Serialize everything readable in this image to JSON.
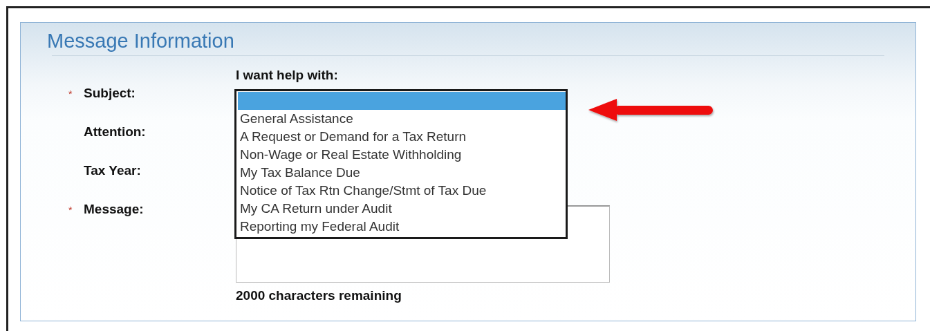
{
  "panel": {
    "title": "Message Information"
  },
  "fields": [
    {
      "label": "Subject:",
      "required_mark": "*"
    },
    {
      "label": "Attention:"
    },
    {
      "label": "Tax Year:"
    },
    {
      "label": "Message:",
      "required_mark": "*"
    }
  ],
  "subject": {
    "prompt": "I want help with:",
    "blank_option_selected": true,
    "options": [
      {
        "label": "General Assistance",
        "selected": false
      },
      {
        "label": "A Request or Demand for a Tax Return",
        "selected": false
      },
      {
        "label": "Non-Wage or Real Estate Withholding",
        "selected": false
      },
      {
        "label": "My Tax Balance Due",
        "selected": false
      },
      {
        "label": "Notice of Tax Rtn Change/Stmt of Tax Due",
        "selected": false
      },
      {
        "label": "My CA Return under Audit",
        "selected": false
      },
      {
        "label": "Reporting my Federal Audit",
        "selected": false
      }
    ]
  },
  "message": {
    "remaining": "2000 characters remaining"
  }
}
